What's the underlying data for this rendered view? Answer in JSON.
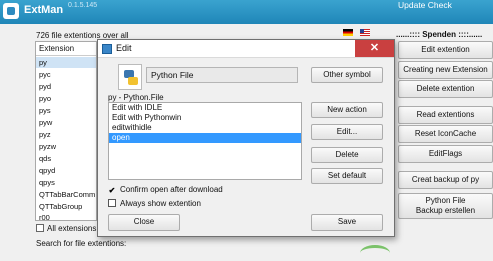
{
  "app": {
    "title": "ExtMan",
    "version": "0.1.5.145",
    "update_label": "Update Check"
  },
  "main": {
    "count_label": "726 file extentions over all",
    "column_header": "Extension",
    "extensions": [
      "py",
      "pyc",
      "pyd",
      "pyo",
      "pys",
      "pyw",
      "pyz",
      "pyzw",
      "qds",
      "qpyd",
      "qpys",
      "QTTabBarComm",
      "QTTabGroup",
      "r00"
    ],
    "selected_index": 0,
    "all_ext_label": "All extensions c",
    "search_label": "Search for file extentions:"
  },
  "right": {
    "spenden_label": "......:::: Spenden ::::......",
    "buttons": [
      "Edit extention",
      "Creating new Extension",
      "Delete extention",
      "Read extentions",
      "Reset IconCache",
      "EditFlags",
      "Creat backup of py"
    ],
    "backup_line1": "Python File",
    "backup_line2": "Backup erstellen"
  },
  "dialog": {
    "title": "Edit",
    "close_symbol": "✕",
    "name_value": "Python File",
    "other_symbol_label": "Other symbol",
    "assoc_label": "py - Python.File",
    "actions": [
      "Edit with IDLE",
      "Edit with Pythonwin",
      "editwithidle",
      "open"
    ],
    "selected_action": 3,
    "new_action_label": "New action",
    "edit_label": "Edit...",
    "delete_label": "Delete",
    "set_default_label": "Set default",
    "confirm_label": "Confirm open after download",
    "confirm_checked": true,
    "always_label": "Always show extention",
    "always_checked": false,
    "close_label": "Close",
    "save_label": "Save"
  }
}
